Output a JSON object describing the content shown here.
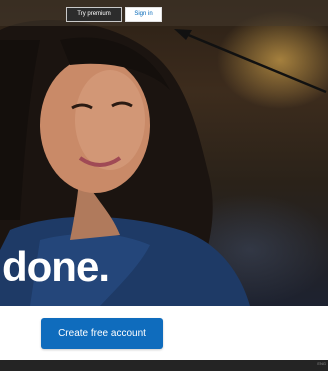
{
  "header": {
    "try_premium_label": "Try premium",
    "sign_in_label": "Sign in"
  },
  "hero": {
    "headline": "done."
  },
  "cta": {
    "label": "Create free account"
  },
  "footer": {
    "text": "ENG"
  },
  "colors": {
    "accent": "#0f6cbd",
    "footer_bg": "#242424"
  }
}
